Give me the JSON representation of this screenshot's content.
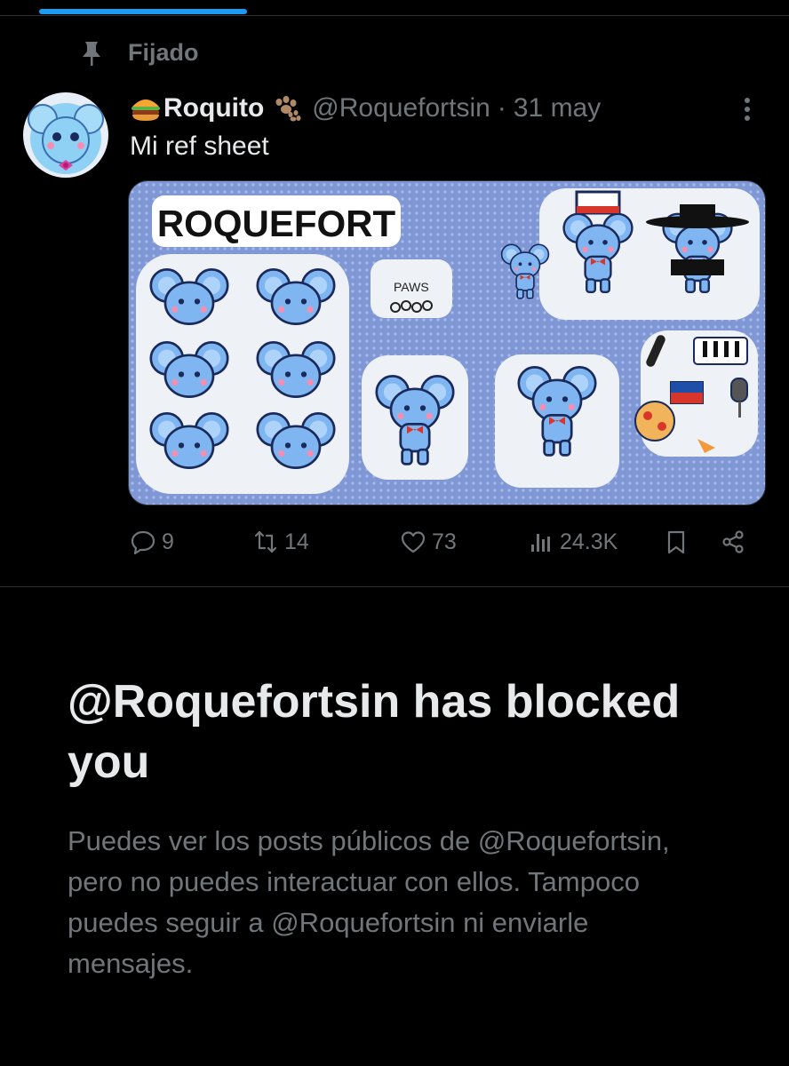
{
  "tabs": {
    "active_indicator_color": "#1d9bf0"
  },
  "pinned": {
    "icon": "pin-icon",
    "label": "Fijado"
  },
  "tweet": {
    "avatar": "avatar-image",
    "name_emoji": "burger-icon",
    "name": "Roquito",
    "name_badge": "paw-prints-icon",
    "handle": "@Roquefortsin",
    "separator": "·",
    "date": "31 may",
    "text": "Mi ref sheet",
    "media": {
      "kind": "reference-sheet-image",
      "title_text": "ROQUEFORT",
      "paws_label": "PAWS",
      "background_color": "#7f97d4",
      "character_color": "#7fb6f2"
    },
    "actions": {
      "replies": "9",
      "reposts": "14",
      "likes": "73",
      "views": "24.3K"
    }
  },
  "blocked": {
    "title": "@Roquefortsin has blocked you",
    "description": "Puedes ver los posts públicos de @Roquefortsin, pero no puedes interactuar con ellos. Tampoco puedes seguir a @Roquefortsin ni enviarle mensajes."
  }
}
